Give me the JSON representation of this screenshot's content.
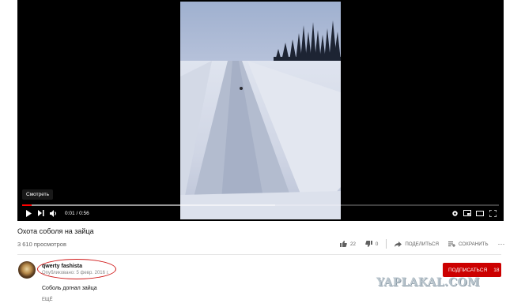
{
  "player": {
    "tooltip": "Смотреть",
    "time": "0:01 / 0:56",
    "progress": 0.02,
    "buffered": 0.53
  },
  "video": {
    "title": "Охота соболя на зайца",
    "views": "3 610 просмотров",
    "likes": "22",
    "dislikes": "0",
    "share_label": "ПОДЕЛИТЬСЯ",
    "save_label": "СОХРАНИТЬ"
  },
  "channel": {
    "name": "qwerty fashista",
    "published": "Опубликовано: 5 февр. 2016 г.",
    "subscribe_label": "ПОДПИСАТЬСЯ",
    "subscribers": "18"
  },
  "description": {
    "text": "Соболь догнал зайца",
    "more_label": "ЕЩЁ"
  },
  "watermark": "YAPLAKAL.COM",
  "colors": {
    "accent": "#cc0000",
    "annotation": "#d01818",
    "progress": "#ff0000"
  }
}
